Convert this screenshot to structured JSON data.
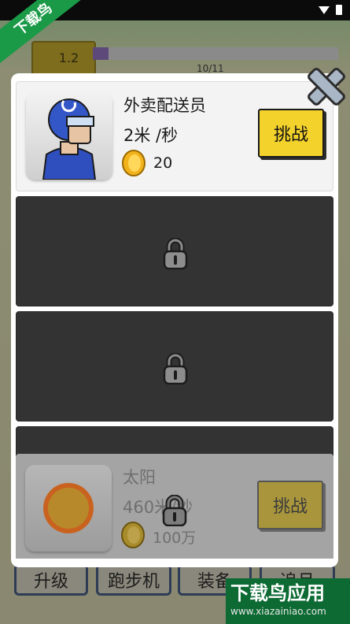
{
  "hud": {
    "level": "1.2",
    "progress_text": "10/11",
    "progress_fraction": 0.06
  },
  "dialog": {
    "items": [
      {
        "name": "外卖配送员",
        "speed": "2米 /秒",
        "price": "20",
        "button": "挑战",
        "locked": false
      },
      {
        "locked": true
      },
      {
        "locked": true
      },
      {
        "locked": true
      },
      {
        "name": "太阳",
        "speed": "460米/秒",
        "price": "100万",
        "button": "挑战",
        "locked": false,
        "dimmed": true
      }
    ]
  },
  "bottom_nav": [
    "升级",
    "跑步机",
    "装备",
    "追月"
  ],
  "watermark": {
    "corner": "下载鸟",
    "brand": "下载鸟应用",
    "url": "www.xiazainiao.com"
  },
  "colors": {
    "challenge_button": "#f4d22c",
    "locked_card": "#333333",
    "watermark_green": "#1a9a47"
  },
  "icons": [
    "close-icon",
    "lock-icon",
    "coin-icon",
    "wifi-icon",
    "battery-icon"
  ]
}
